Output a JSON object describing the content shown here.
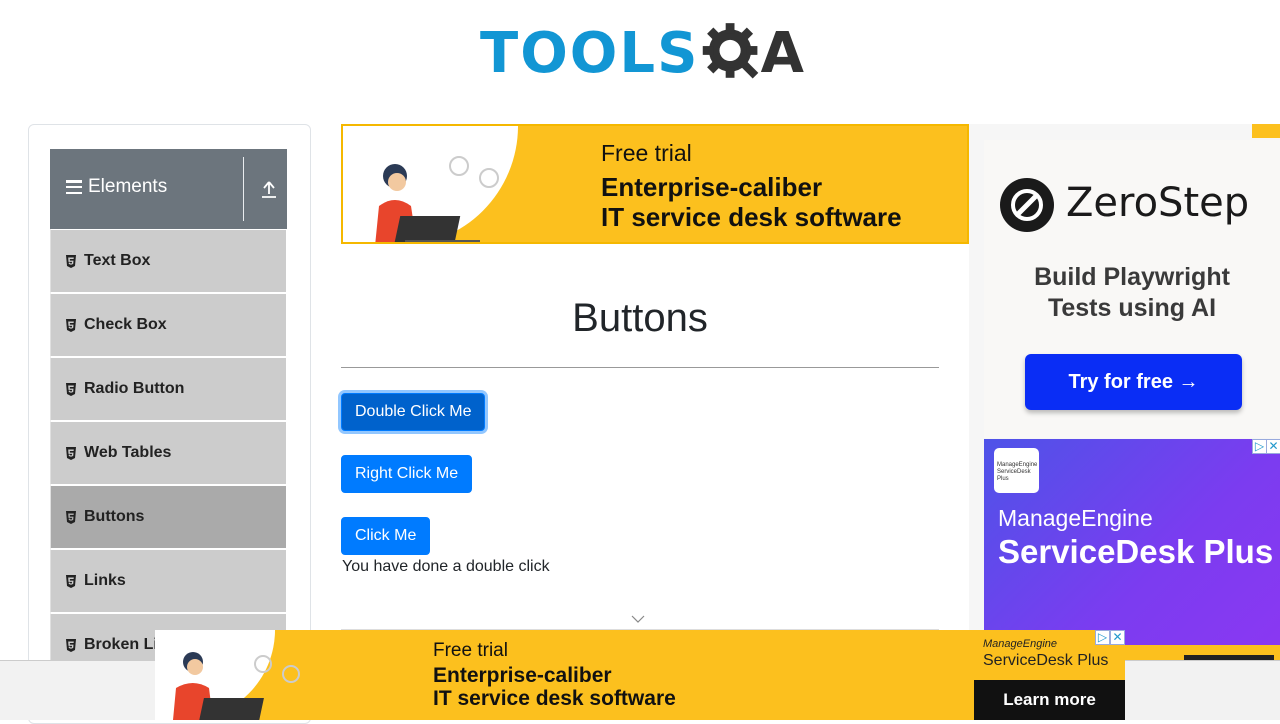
{
  "header": {
    "logo_tools": "TOOLS",
    "logo_a": "A",
    "logo_color": "#1296d4"
  },
  "sidebar": {
    "group_title": "Elements",
    "items": [
      {
        "label": "Text Box"
      },
      {
        "label": "Check Box"
      },
      {
        "label": "Radio Button"
      },
      {
        "label": "Web Tables"
      },
      {
        "label": "Buttons",
        "active": true
      },
      {
        "label": "Links"
      },
      {
        "label": "Broken Links - Images"
      }
    ]
  },
  "top_ad": {
    "line1": "Free trial",
    "line2": "Enterprise-caliber",
    "line3": "IT service desk software"
  },
  "main": {
    "title": "Buttons",
    "double_click_label": "Double Click Me",
    "right_click_label": "Right Click Me",
    "click_label": "Click Me",
    "message": "You have done a double click",
    "accent": "#007bff"
  },
  "right_ad_zerostep": {
    "brand": "ZeroStep",
    "subtitle_line1": "Build Playwright",
    "subtitle_line2": "Tests using AI",
    "cta": "Try for free →",
    "cta_color": "#0a2df5"
  },
  "right_ad_manageengine": {
    "badge_line1": "ManageEngine",
    "badge_line2": "ServiceDesk Plus",
    "line1": "ManageEngine",
    "line2": "ServiceDesk Plus"
  },
  "bottom_ad": {
    "line1": "Free trial",
    "line2": "Enterprise-caliber",
    "line3": "IT service desk software",
    "brand1": "ManageEngine",
    "brand2": "ServiceDesk Plus",
    "cta": "Learn more"
  }
}
